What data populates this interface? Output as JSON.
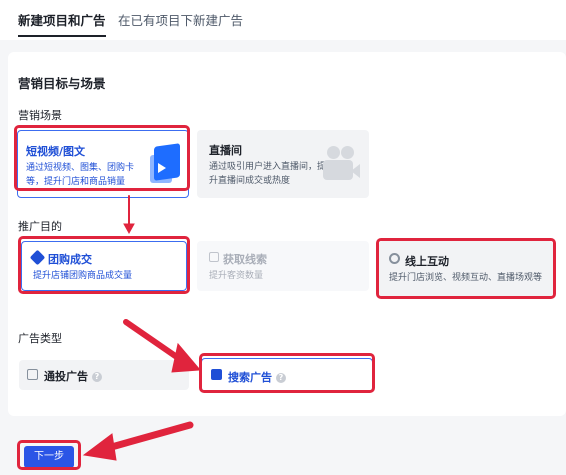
{
  "tabs": [
    {
      "label": "新建项目和广告",
      "active": true
    },
    {
      "label": "在已有项目下新建广告",
      "active": false
    }
  ],
  "section_title": "营销目标与场景",
  "marketing_scene": {
    "label": "营销场景",
    "options": [
      {
        "title": "短视频/图文",
        "desc": "通过短视频、图集、团购卡等，提升门店和商品销量",
        "selected": true,
        "icon": "short-video-illustration"
      },
      {
        "title": "直播间",
        "desc": "通过吸引用户进入直播间，提升直播间成交或热度",
        "selected": false,
        "icon": "live-room-illustration"
      }
    ]
  },
  "promotion_goal": {
    "label": "推广目的",
    "options": [
      {
        "title": "团购成交",
        "desc": "提升店铺团购商品成交量",
        "selected": true,
        "icon": "tag-icon"
      },
      {
        "title": "获取线索",
        "desc": "提升客资数量",
        "selected": false,
        "disabled": true,
        "icon": "leads-icon"
      },
      {
        "title": "线上互动",
        "desc": "提升门店浏览、视频互动、直播场观等",
        "selected": false,
        "icon": "badge-icon"
      }
    ]
  },
  "ad_type": {
    "label": "广告类型",
    "options": [
      {
        "title": "通投广告",
        "selected": false,
        "icon": "auto-ad-icon",
        "help": "?"
      },
      {
        "title": "搜索广告",
        "selected": true,
        "icon": "search-ad-icon",
        "help": "?"
      }
    ]
  },
  "next_button": "下一步",
  "colors": {
    "accent": "#2b55e6",
    "annotation_red": "#e0243d"
  }
}
